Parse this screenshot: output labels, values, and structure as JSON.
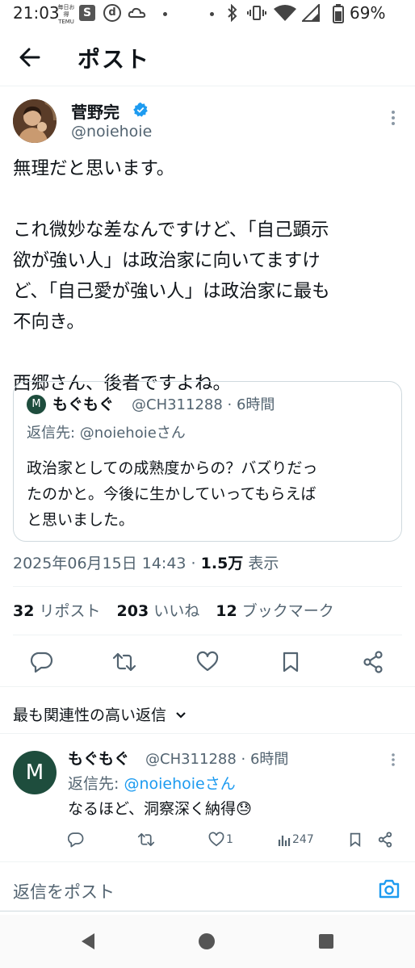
{
  "status_bar": {
    "time": "21:03",
    "temu_line1": "毎日お得",
    "temu_line2": "TEMU",
    "s_app": "S",
    "d_app": "d",
    "battery": "69%",
    "icons": [
      "temu-icon",
      "s-app-icon",
      "d-app-icon",
      "cloud-icon",
      "dot-icon",
      "bluetooth-icon",
      "vibrate-icon",
      "wifi-icon",
      "signal-icon",
      "battery-icon"
    ]
  },
  "header": {
    "title": "ポスト"
  },
  "tweet": {
    "author_name": "菅野完",
    "handle": "@noiehoie",
    "lines": [
      "無理だと思います。",
      "",
      "これ微妙な差なんですけど、「自己顕示",
      "欲が強い人」は政治家に向いてますけ",
      "ど、「自己愛が強い人」は政治家に最も",
      "不向き。",
      "",
      "西郷さん、後者ですよね。"
    ]
  },
  "quote": {
    "avatar_letter": "M",
    "name": "もぐもぐ",
    "meta": "@CH311288 · 6時間",
    "reply_to": "返信先: @noiehoieさん",
    "lines": [
      "政治家としての成熟度からの？バズりだっ",
      "たのかと。今後に生かしていってもらえば",
      "と思いました。"
    ]
  },
  "timestamp": {
    "datetime": "2025年06月15日 14:43",
    "separator": " · ",
    "views": "1.5万",
    "views_label": " 表示"
  },
  "stats": {
    "reposts": "32",
    "reposts_label": "リポスト",
    "likes": "203",
    "likes_label": "いいね",
    "bookmarks": "12",
    "bookmarks_label": "ブックマーク"
  },
  "replies_section": {
    "sort_label": "最も関連性の高い返信"
  },
  "reply": {
    "avatar_letter": "M",
    "name": "もぐもぐ",
    "meta": "@CH311288 · 6時間",
    "reply_to_prefix": "返信先: ",
    "reply_to_handle": "@noiehoieさん",
    "text": "なるほど、洞察深く納得",
    "emoji": "😓",
    "like_count": "1",
    "view_count": "247"
  },
  "compose": {
    "placeholder": "返信をポスト"
  },
  "colors": {
    "accent": "#1d9bf0",
    "text_primary": "#0f1419",
    "text_secondary": "#536471",
    "avatar_green": "#1e4d3d",
    "border": "#cfd9de"
  }
}
